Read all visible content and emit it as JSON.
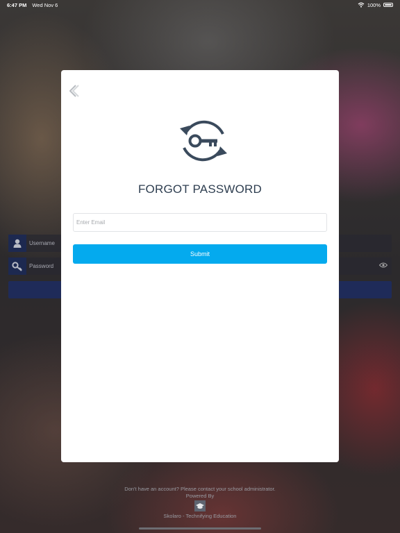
{
  "status_bar": {
    "time": "6:47 PM",
    "date": "Wed Nov 6",
    "battery": "100%"
  },
  "login": {
    "username_placeholder": "Username",
    "password_placeholder": "Password"
  },
  "modal": {
    "title": "FORGOT PASSWORD",
    "email_placeholder": "Enter Email",
    "submit_label": "Submit"
  },
  "footer": {
    "contact_text": "Don't have an account? Please contact your school administrator.",
    "powered_by": "Powered By",
    "tagline": "Skolaro - Technifying Education"
  },
  "colors": {
    "accent": "#04aaee",
    "title": "#2e3e50",
    "login_button": "#1f2b59"
  },
  "icons": [
    "back-chevron-icon",
    "key-refresh-icon",
    "user-icon",
    "key-icon",
    "eye-icon",
    "graduation-cap-icon",
    "wifi-icon",
    "battery-icon"
  ]
}
